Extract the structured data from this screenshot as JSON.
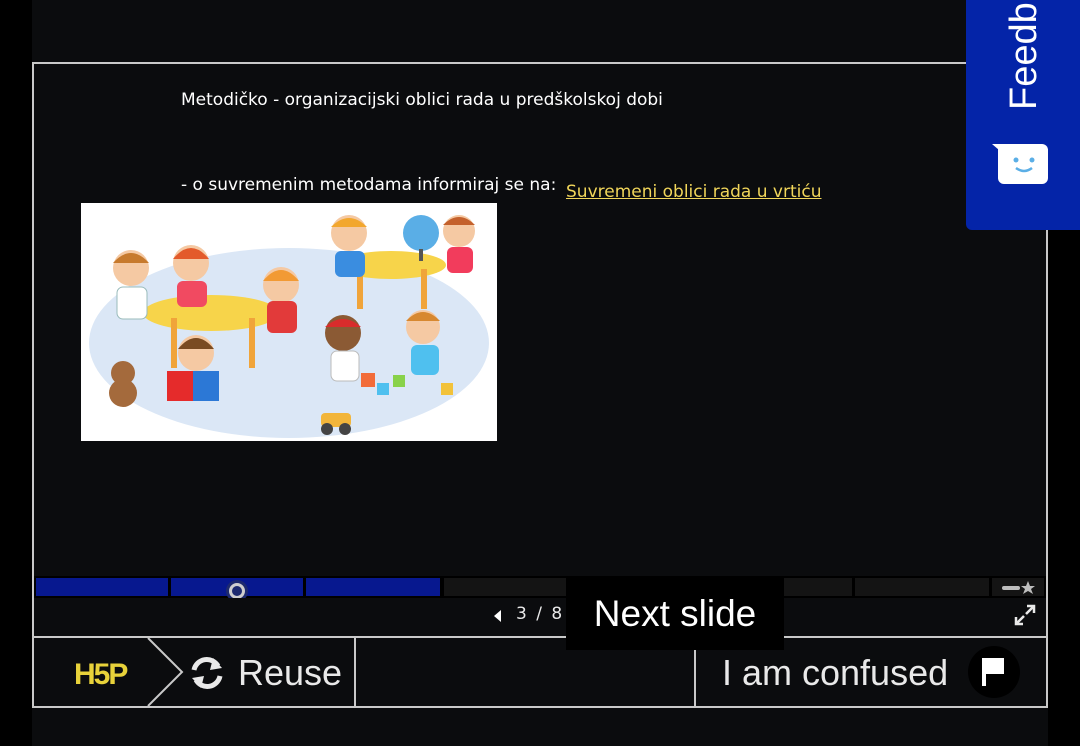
{
  "slide": {
    "title": "Metodičko - organizacijski oblici rada u predškolskoj dobi",
    "info_text": "- o suvremenim metodama informiraj se na:",
    "link_text": "Suvremeni oblici rada u vrtiću"
  },
  "navigation": {
    "counter": "3 / 8",
    "current_slide": 3,
    "total_slides": 8,
    "next_tooltip": "Next slide"
  },
  "footer": {
    "logo_text": "H5P",
    "reuse_label": "Reuse",
    "confused_label": "I am confused"
  },
  "feedback": {
    "label": "Feedb"
  },
  "icons": {
    "prev": "chevron-left-icon",
    "next": "chevron-right-icon",
    "fullscreen": "fullscreen-icon",
    "reuse": "refresh-icon",
    "flag": "flag-icon",
    "feedback": "chat-face-icon",
    "star": "star-icon"
  },
  "colors": {
    "accent_link": "#f1d65a",
    "progress_done": "#07188f",
    "progress_pending": "#141414",
    "feedback_bg": "#0424a8",
    "logo": "#e8d23a"
  }
}
